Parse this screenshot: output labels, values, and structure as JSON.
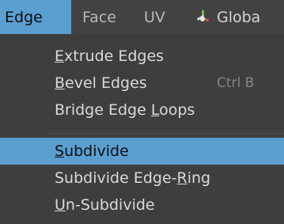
{
  "menubar": {
    "items": [
      {
        "label": "Edge",
        "active": true
      },
      {
        "label": "Face",
        "active": false
      },
      {
        "label": "UV",
        "active": false
      },
      {
        "label": "Globa",
        "active": false,
        "icon": "transform-orientation-icon"
      }
    ]
  },
  "edge_menu": {
    "items": [
      {
        "label": "Extrude Edges",
        "underline": "E",
        "shortcut": ""
      },
      {
        "label": "Bevel Edges",
        "underline": "B",
        "shortcut": "Ctrl B"
      },
      {
        "label": "Bridge Edge Loops",
        "underline": "L",
        "shortcut": ""
      },
      {
        "label": "Subdivide",
        "underline": "S",
        "shortcut": "",
        "highlighted": true
      },
      {
        "label": "Subdivide Edge-Ring",
        "underline": "R",
        "shortcut": ""
      },
      {
        "label": "Un-Subdivide",
        "underline": "U",
        "shortcut": ""
      }
    ]
  },
  "colors": {
    "accent": "#5b9fd0",
    "menu_bg": "#3e3e3e",
    "text": "#dadada",
    "shortcut_text": "#858585"
  }
}
